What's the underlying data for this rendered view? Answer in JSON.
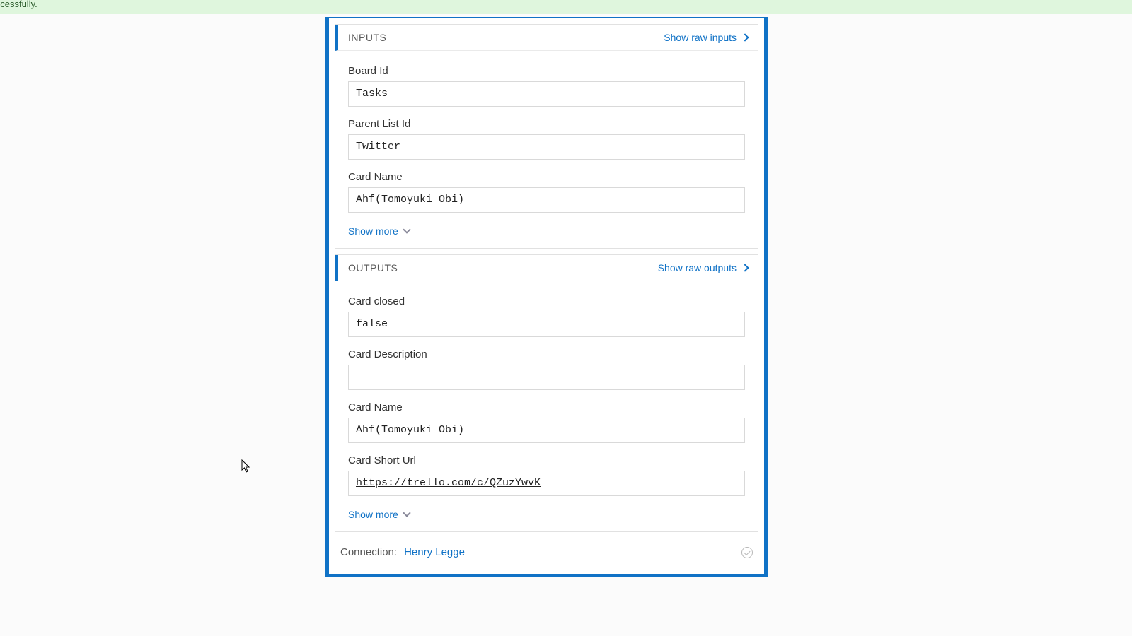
{
  "banner": {
    "text": "successfully."
  },
  "inputs": {
    "title": "INPUTS",
    "raw_link": "Show raw inputs",
    "fields": {
      "board_id": {
        "label": "Board Id",
        "value": "Tasks"
      },
      "parent_list_id": {
        "label": "Parent List Id",
        "value": "Twitter"
      },
      "card_name": {
        "label": "Card Name",
        "value": "Ahf(Tomoyuki Obi)"
      }
    },
    "show_more": "Show more"
  },
  "outputs": {
    "title": "OUTPUTS",
    "raw_link": "Show raw outputs",
    "fields": {
      "card_closed": {
        "label": "Card closed",
        "value": "false"
      },
      "card_description": {
        "label": "Card Description",
        "value": ""
      },
      "card_name": {
        "label": "Card Name",
        "value": "Ahf(Tomoyuki Obi)"
      },
      "card_short_url": {
        "label": "Card Short Url",
        "value": "https://trello.com/c/QZuzYwvK"
      }
    },
    "show_more": "Show more"
  },
  "connection": {
    "label": "Connection:",
    "name": "Henry Legge"
  }
}
